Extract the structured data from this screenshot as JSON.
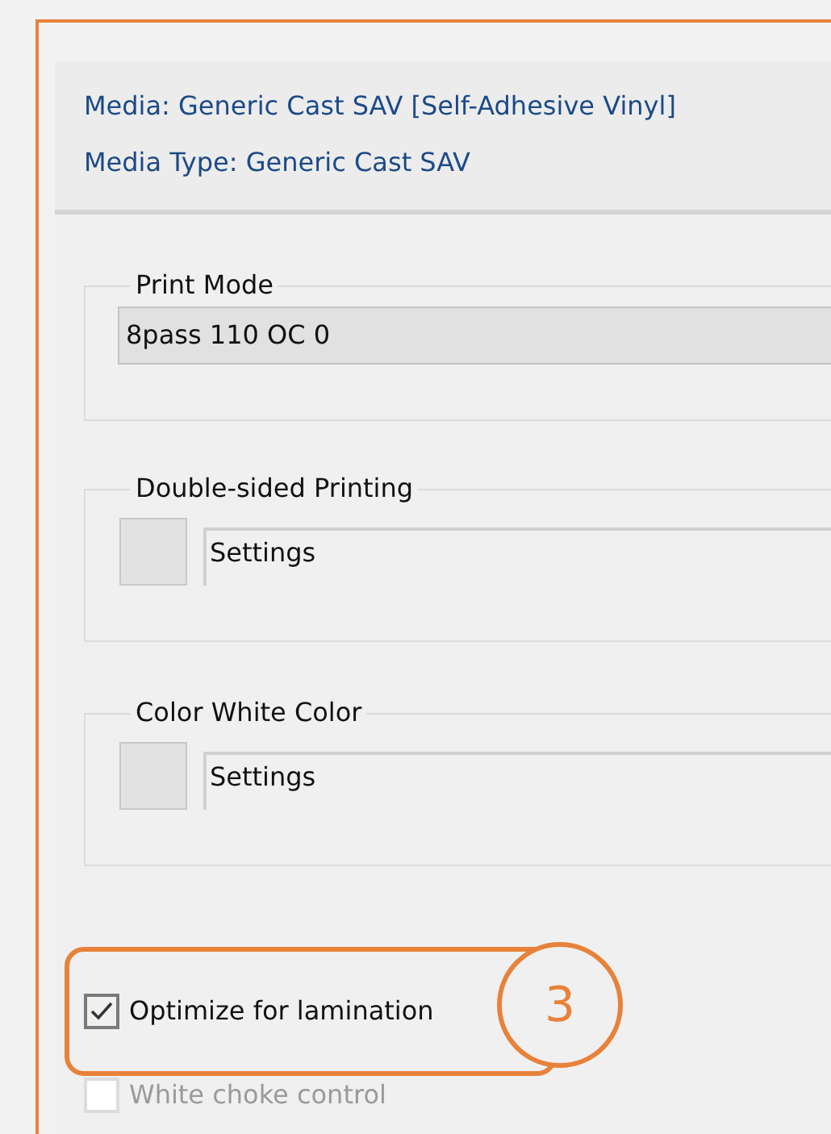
{
  "media_info": [
    "Media: Generic Cast SAV [Self-Adhesive Vinyl]",
    "Media Type: Generic Cast SAV"
  ],
  "groups": [
    {
      "title": "Print Mode",
      "kind": "dropdown",
      "value": "8pass 110 OC 0"
    },
    {
      "title": "Double-sided Printing",
      "kind": "swatch-field",
      "value": "Settings"
    },
    {
      "title": "Color White Color",
      "kind": "swatch-field",
      "value": "Settings"
    }
  ],
  "checkboxes": [
    {
      "label": "Optimize for lamination",
      "checked": true,
      "disabled": false,
      "highlighted": true
    },
    {
      "label": "White choke control",
      "checked": false,
      "disabled": true,
      "highlighted": false
    }
  ],
  "callout": "3"
}
